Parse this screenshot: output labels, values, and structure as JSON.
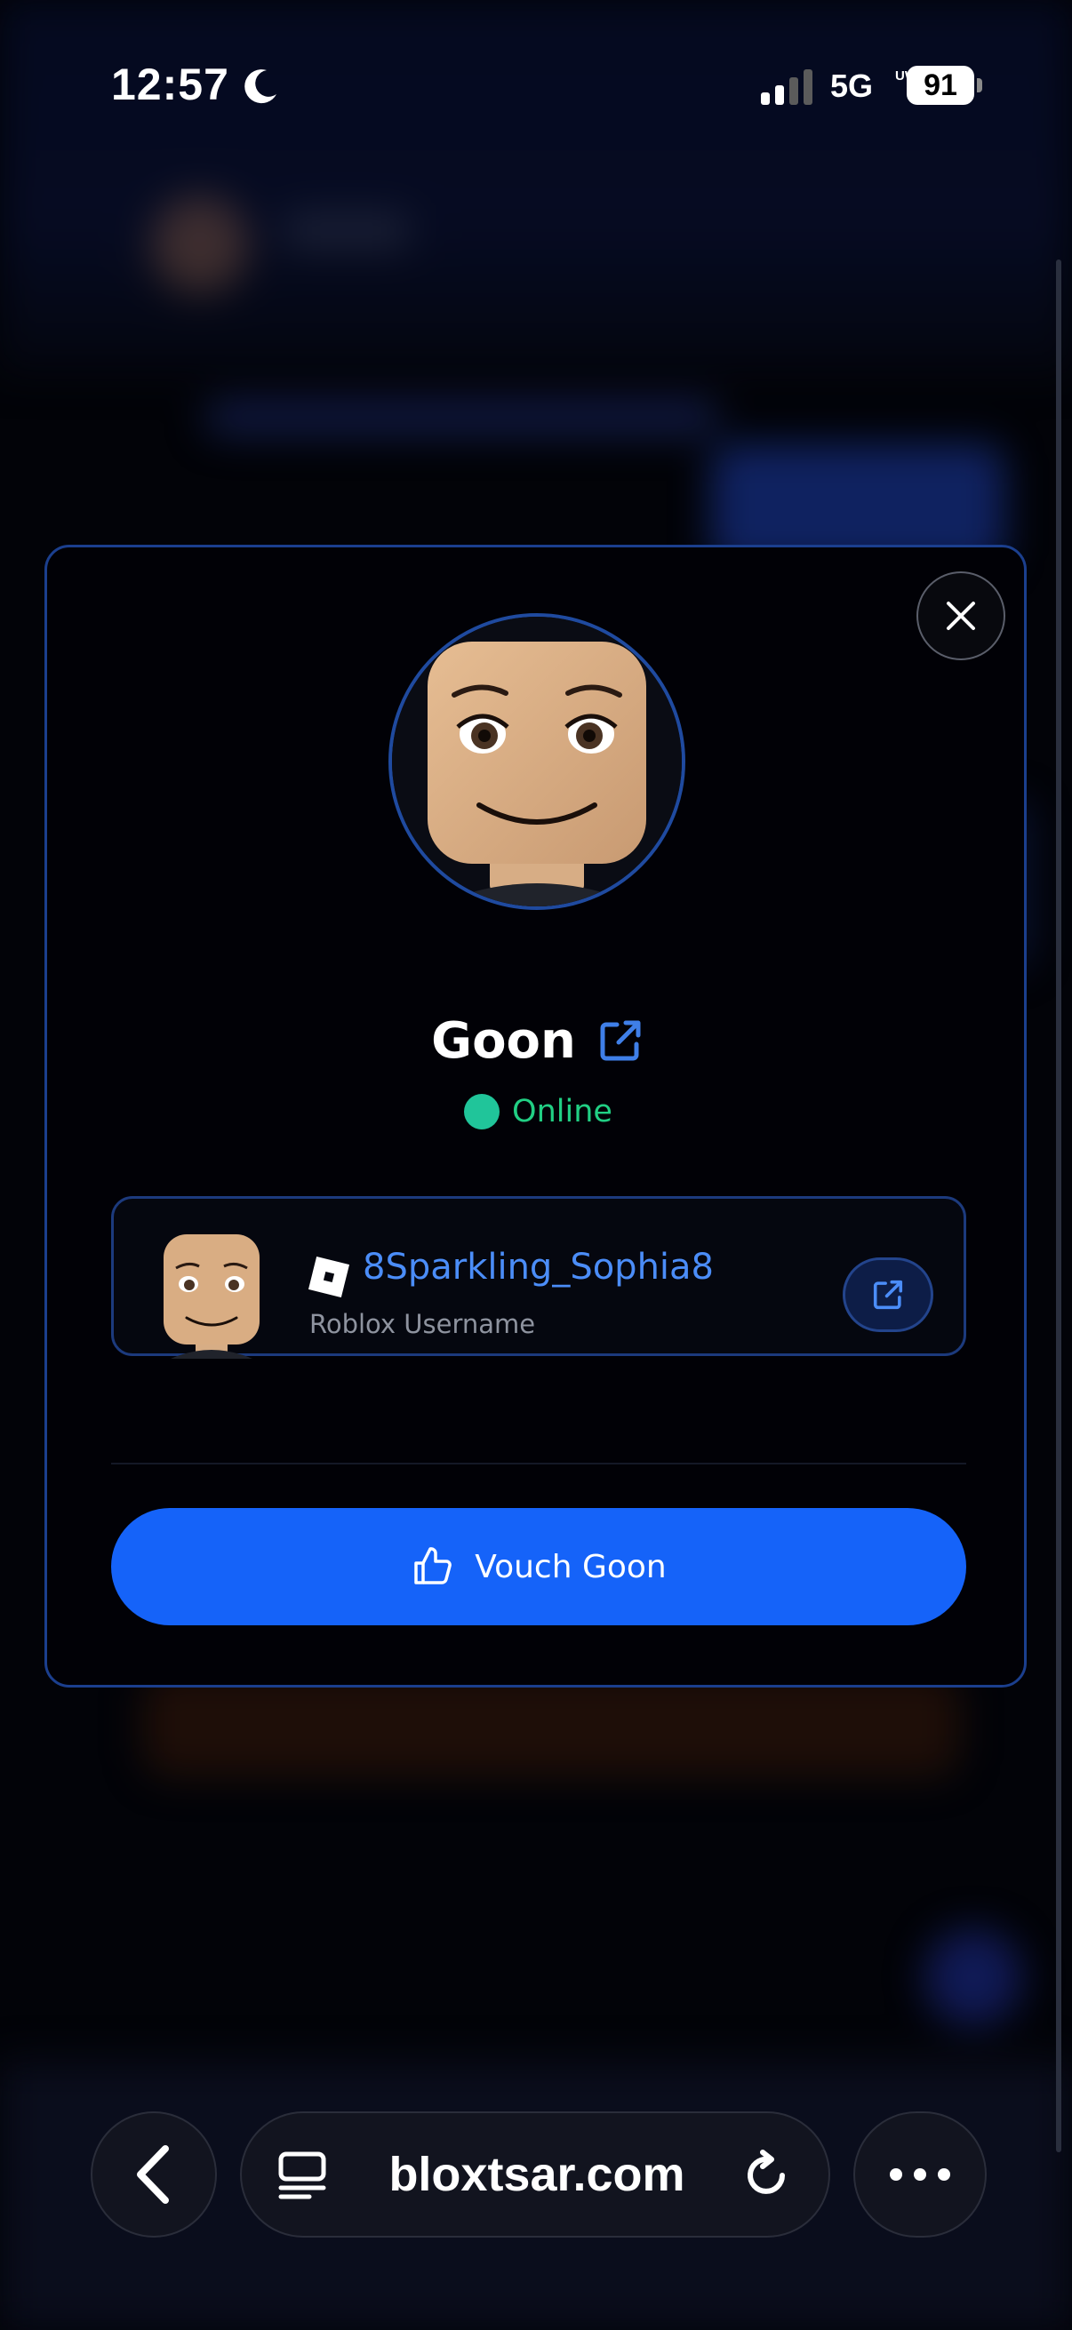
{
  "status_bar": {
    "time": "12:57",
    "network": "5G",
    "network_sub": "UW",
    "battery": "91"
  },
  "modal": {
    "profile_name": "Goon",
    "status": "Online",
    "status_color": "#21cf84",
    "roblox": {
      "username": "8Sparkling_Sophia8",
      "caption": "Roblox Username"
    },
    "vouch_label": "Vouch Goon",
    "accent_color": "#1563f9",
    "link_color": "#4b8df8"
  },
  "browser": {
    "url": "bloxtsar.com"
  },
  "icons": {
    "close": "close-icon",
    "external_link": "external-link-icon",
    "roblox_logo": "roblox-logo-icon",
    "thumbs_up": "thumbs-up-icon",
    "back": "chevron-left-icon",
    "tabs": "tab-list-icon",
    "reload": "reload-icon",
    "more": "more-icon"
  }
}
